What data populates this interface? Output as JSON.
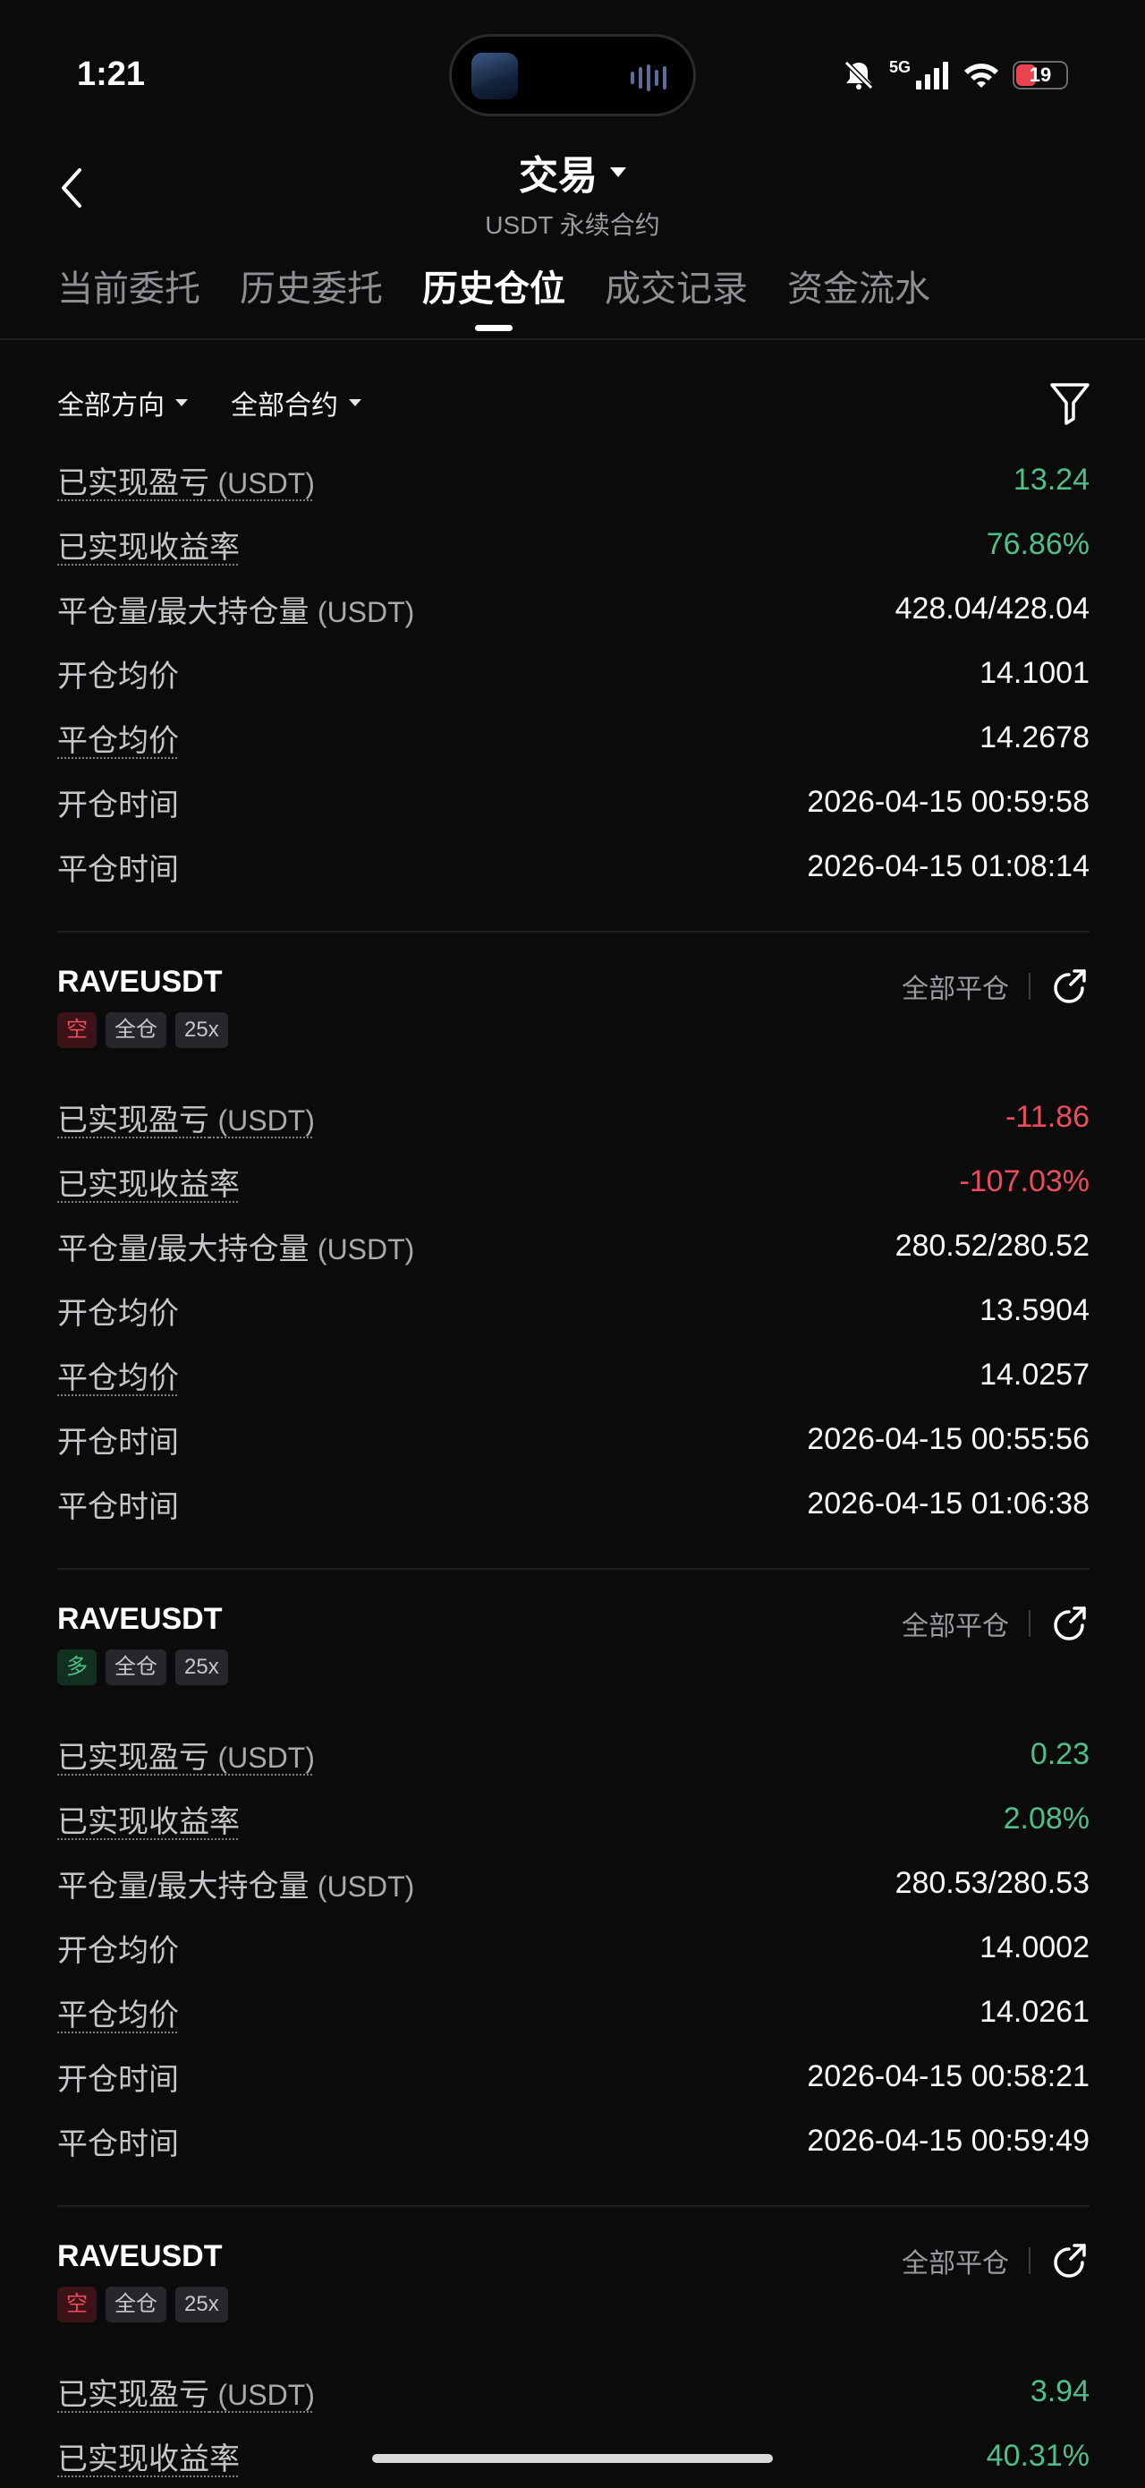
{
  "status_bar": {
    "time": "1:21",
    "network": "5G",
    "battery": "19"
  },
  "header": {
    "title": "交易",
    "subtitle": "USDT 永续合约"
  },
  "tabs": [
    {
      "label": "当前委托"
    },
    {
      "label": "历史委托"
    },
    {
      "label": "历史仓位"
    },
    {
      "label": "成交记录"
    },
    {
      "label": "资金流水"
    }
  ],
  "filters": {
    "direction": "全部方向",
    "contract": "全部合约"
  },
  "labels": {
    "realized_pnl": "已实现盈亏",
    "realized_pnl_unit": "(USDT)",
    "realized_roi": "已实现收益率",
    "close_max": "平仓量/最大持仓量",
    "close_max_unit": "(USDT)",
    "open_avg": "开仓均价",
    "close_avg": "平仓均价",
    "open_time": "开仓时间",
    "close_time": "平仓时间",
    "close_all": "全部平仓"
  },
  "top_record": {
    "realized_pnl": "13.24",
    "realized_roi": "76.86%",
    "close_max": "428.04/428.04",
    "open_avg": "14.1001",
    "close_avg": "14.2678",
    "open_time": "2026-04-15 00:59:58",
    "close_time": "2026-04-15 01:08:14"
  },
  "cards": [
    {
      "symbol": "RAVEUSDT",
      "side": "空",
      "margin": "全仓",
      "leverage": "25x",
      "realized_pnl": "-11.86",
      "realized_roi": "-107.03%",
      "close_max": "280.52/280.52",
      "open_avg": "13.5904",
      "close_avg": "14.0257",
      "open_time": "2026-04-15 00:55:56",
      "close_time": "2026-04-15 01:06:38"
    },
    {
      "symbol": "RAVEUSDT",
      "side": "多",
      "margin": "全仓",
      "leverage": "25x",
      "realized_pnl": "0.23",
      "realized_roi": "2.08%",
      "close_max": "280.53/280.53",
      "open_avg": "14.0002",
      "close_avg": "14.0261",
      "open_time": "2026-04-15 00:58:21",
      "close_time": "2026-04-15 00:59:49"
    },
    {
      "symbol": "RAVEUSDT",
      "side": "空",
      "margin": "全仓",
      "leverage": "25x",
      "realized_pnl": "3.94",
      "realized_roi": "40.31%"
    }
  ],
  "colors": {
    "positive": "#4fbf8a",
    "negative": "#ea4d5d",
    "background": "#0b0b0c"
  }
}
